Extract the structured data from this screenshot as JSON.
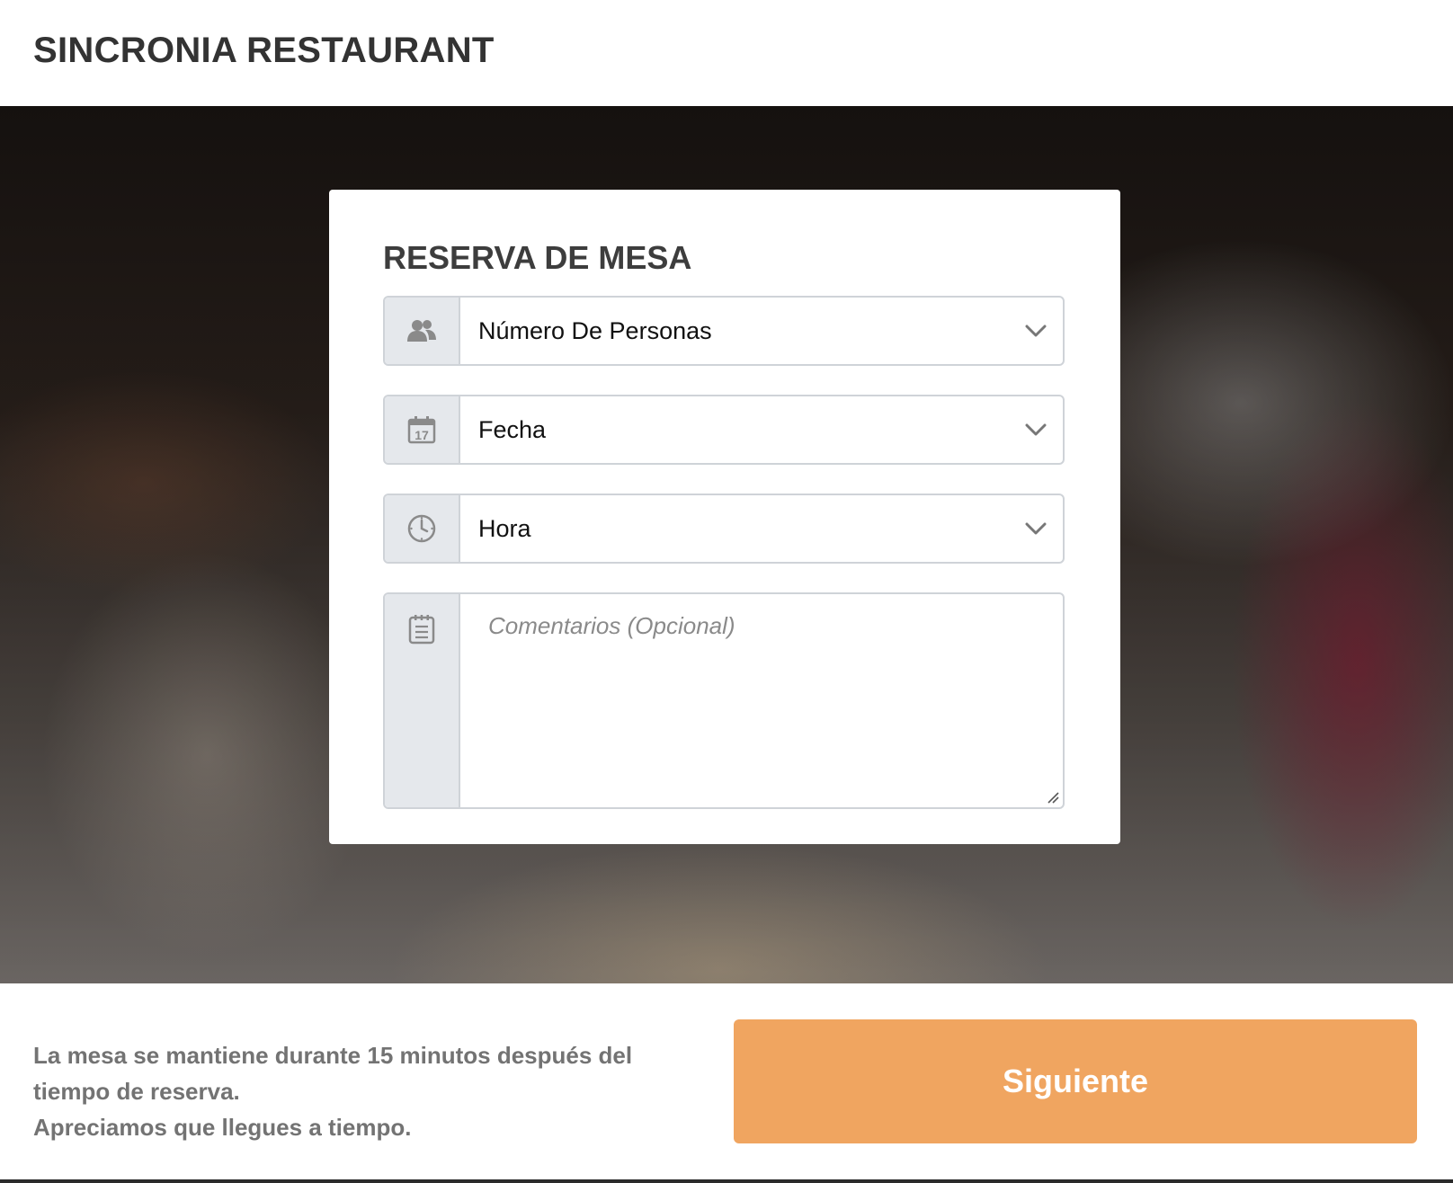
{
  "header": {
    "brand": "SINCRONIA RESTAURANT"
  },
  "form": {
    "title": "RESERVA DE MESA",
    "fields": [
      {
        "icon": "people-icon",
        "value": "Número De Personas"
      },
      {
        "icon": "calendar-icon",
        "value": "Fecha",
        "icon_text": "17"
      },
      {
        "icon": "clock-icon",
        "value": "Hora"
      }
    ],
    "comments": {
      "icon": "notepad-icon",
      "placeholder": "Comentarios (Opcional)"
    }
  },
  "footer": {
    "note_lines": [
      "La mesa se mantiene durante 15 minutos después del",
      "tiempo de reserva.",
      "Apreciamos que llegues a tiempo."
    ],
    "next_label": "Siguiente"
  },
  "colors": {
    "accent": "#f0a560",
    "addon_bg": "#e5e8ec",
    "field_border": "#cfd3d8",
    "icon_gray": "#8a8a8a"
  }
}
